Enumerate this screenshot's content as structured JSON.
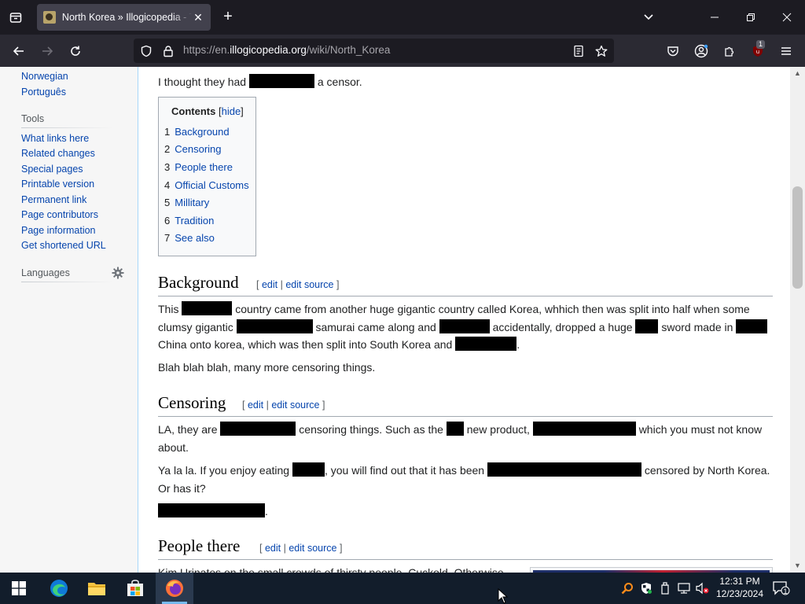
{
  "browser": {
    "tab_title": "North Korea » Illogicopedia - Th",
    "url_prefix": "https://en.",
    "url_host": "illogicopedia.org",
    "url_path": "/wiki/North_Korea",
    "extension_badge": "1"
  },
  "sidebar": {
    "lang_links": [
      "Norwegian",
      "Português"
    ],
    "tools_heading": "Tools",
    "tools": [
      "What links here",
      "Related changes",
      "Special pages",
      "Printable version",
      "Permanent link",
      "Page contributors",
      "Page information",
      "Get shortened URL"
    ],
    "languages_heading": "Languages"
  },
  "article": {
    "intro_before": "I thought they had",
    "intro_after": "a censor.",
    "toc": {
      "title": "Contents",
      "toggle_open": "[",
      "toggle_label": "hide",
      "toggle_close": "]",
      "items": [
        {
          "num": "1",
          "label": "Background"
        },
        {
          "num": "2",
          "label": "Censoring"
        },
        {
          "num": "3",
          "label": "People there"
        },
        {
          "num": "4",
          "label": "Official Customs"
        },
        {
          "num": "5",
          "label": "Millitary"
        },
        {
          "num": "6",
          "label": "Tradition"
        },
        {
          "num": "7",
          "label": "See also"
        }
      ]
    },
    "edit_links": {
      "open": "[",
      "edit": "edit",
      "sep": "|",
      "edit_source": "edit source",
      "close": "]"
    },
    "background": {
      "heading": "Background",
      "p1_a": "This",
      "p1_b": "country came from another huge gigantic country called Korea, whhich then was split into half when some clumsy gigantic",
      "p1_c": "samurai came along and",
      "p1_d": "accidentally, dropped a huge",
      "p1_e": "sword made in",
      "p1_f": "China onto korea, which was then split into South Korea and",
      "p1_g": ".",
      "p2": "Blah blah blah, many more censoring things."
    },
    "censoring": {
      "heading": "Censoring",
      "p1_a": "LA, they are",
      "p1_b": "censoring things. Such as the",
      "p1_c": "new product,",
      "p1_d": "which you must not know about.",
      "p2_a": "Ya la la. If you enjoy eating",
      "p2_b": ", you will find out that it has been",
      "p2_c": "censored by North Korea. Or has it?",
      "p3_end": "."
    },
    "people": {
      "heading": "People there",
      "p1_partial": "Kim Urinates on the small crowds of thirsty people. Cuckold. Otherwise"
    }
  },
  "taskbar": {
    "time": "12:31 PM",
    "date": "12/23/2024",
    "notifications": "1"
  },
  "colors": {
    "link": "#0645ad",
    "chrome_bg": "#1c1b22",
    "toolbar_bg": "#2b2a33",
    "taskbar_bg": "#121d2b"
  }
}
